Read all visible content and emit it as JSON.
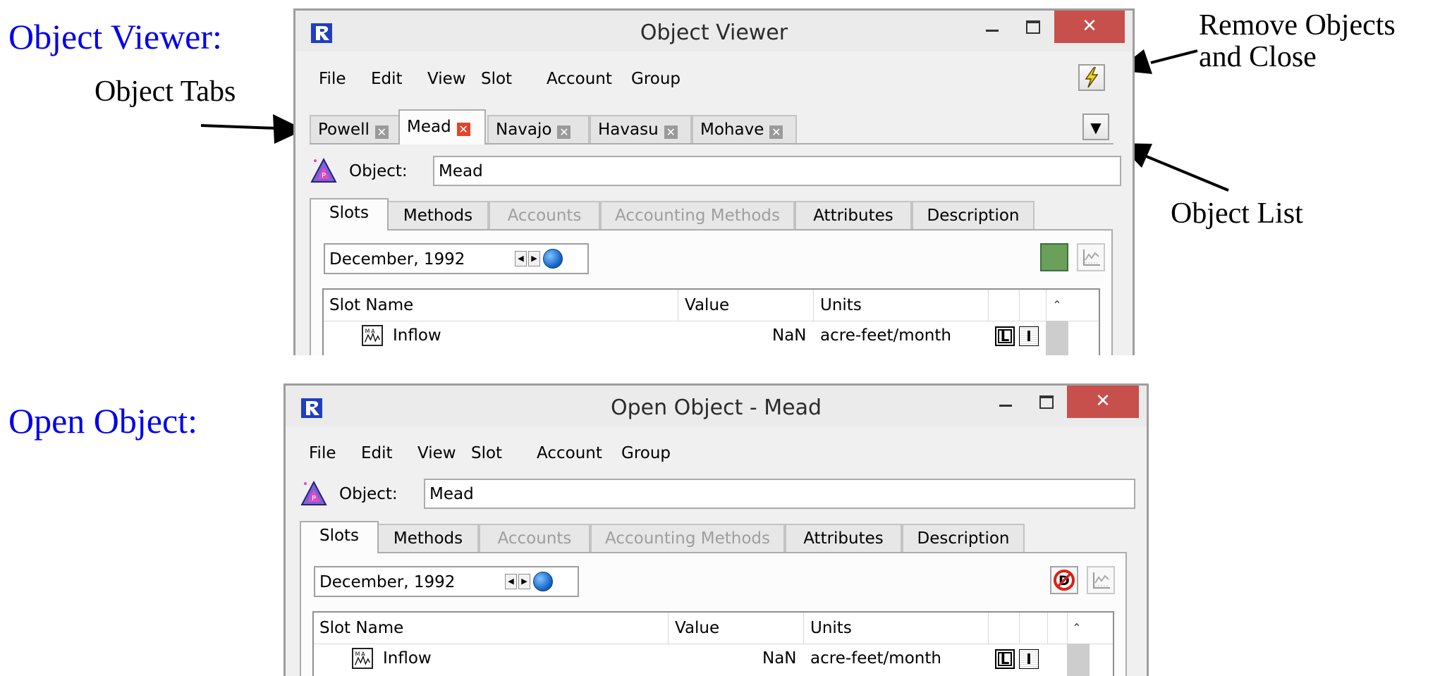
{
  "annotations": {
    "object_viewer": "Object Viewer:",
    "open_object": "Open Object:",
    "object_tabs": "Object Tabs",
    "remove_line1": "Remove Objects",
    "remove_line2": "and Close",
    "object_list": "Object List"
  },
  "viewer": {
    "title": "Object Viewer",
    "menu": [
      "File",
      "Edit",
      "View",
      "Slot",
      "Account",
      "Group"
    ],
    "remove_close_icon": "lightning-icon",
    "object_list_icon": "triangle-down-icon",
    "tabs": [
      {
        "label": "Powell",
        "selected": false
      },
      {
        "label": "Mead",
        "selected": true
      },
      {
        "label": "Navajo",
        "selected": false
      },
      {
        "label": "Havasu",
        "selected": false
      },
      {
        "label": "Mohave",
        "selected": false
      }
    ],
    "object_label": "Object:",
    "object_value": "Mead",
    "slot_tabs": [
      "Slots",
      "Methods",
      "Accounts",
      "Accounting Methods",
      "Attributes",
      "Description"
    ],
    "disabled_tabs": [
      "Accounts",
      "Accounting Methods"
    ],
    "date": "December, 1992",
    "status_color": "#6aa05a",
    "columns": [
      "Slot Name",
      "Value",
      "Units"
    ],
    "rows": [
      {
        "name": "Inflow",
        "value": "NaN",
        "units": "acre-feet/month",
        "flag": "L"
      }
    ]
  },
  "open_object": {
    "title": "Open Object - Mead",
    "menu": [
      "File",
      "Edit",
      "View",
      "Slot",
      "Account",
      "Group"
    ],
    "object_label": "Object:",
    "object_value": "Mead",
    "slot_tabs": [
      "Slots",
      "Methods",
      "Accounts",
      "Accounting Methods",
      "Attributes",
      "Description"
    ],
    "date": "December, 1992",
    "status_icon": "no-display-icon",
    "columns": [
      "Slot Name",
      "Value",
      "Units"
    ],
    "rows": [
      {
        "name": "Inflow",
        "value": "NaN",
        "units": "acre-feet/month",
        "flag": "L"
      }
    ]
  },
  "colors": {
    "annotation_blue": "#0000ee",
    "close_button": "#c7504d",
    "tab_close_red": "#e2442c"
  }
}
